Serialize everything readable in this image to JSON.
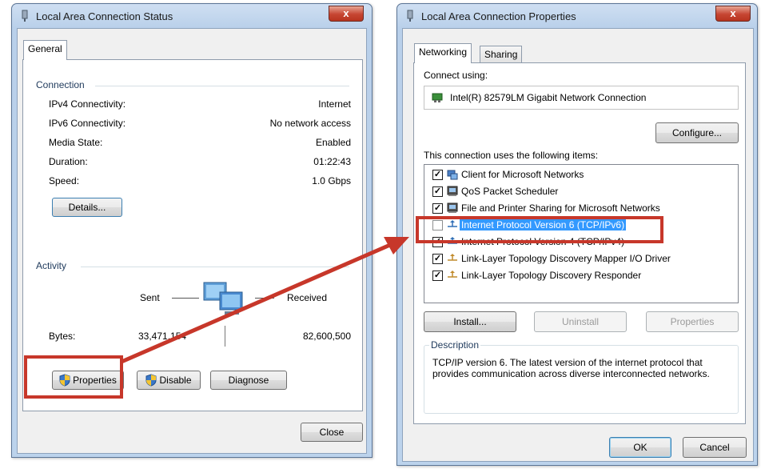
{
  "status_window": {
    "title": "Local Area Connection Status",
    "close_glyph": "x",
    "tabs": [
      {
        "label": "General"
      }
    ],
    "connection": {
      "group_label": "Connection",
      "rows": [
        {
          "label": "IPv4 Connectivity:",
          "value": "Internet"
        },
        {
          "label": "IPv6 Connectivity:",
          "value": "No network access"
        },
        {
          "label": "Media State:",
          "value": "Enabled"
        },
        {
          "label": "Duration:",
          "value": "01:22:43"
        },
        {
          "label": "Speed:",
          "value": "1.0 Gbps"
        }
      ],
      "details_button": "Details..."
    },
    "activity": {
      "group_label": "Activity",
      "sent_label": "Sent",
      "received_label": "Received",
      "bytes_label": "Bytes:",
      "bytes_sent": "33,471,154",
      "bytes_received": "82,600,500"
    },
    "buttons": {
      "properties": "Properties",
      "disable": "Disable",
      "diagnose": "Diagnose",
      "close": "Close"
    }
  },
  "properties_window": {
    "title": "Local Area Connection Properties",
    "close_glyph": "x",
    "tabs": [
      {
        "label": "Networking"
      },
      {
        "label": "Sharing"
      }
    ],
    "connect_using_label": "Connect using:",
    "adapter_name": "Intel(R) 82579LM Gigabit Network Connection",
    "configure_button": "Configure...",
    "items_label": "This connection uses the following items:",
    "items": [
      {
        "label": "Client for Microsoft Networks",
        "checked": true,
        "icon": "network-client-icon"
      },
      {
        "label": "QoS Packet Scheduler",
        "checked": true,
        "icon": "service-icon"
      },
      {
        "label": "File and Printer Sharing for Microsoft Networks",
        "checked": true,
        "icon": "service-icon"
      },
      {
        "label": "Internet Protocol Version 6 (TCP/IPv6)",
        "checked": false,
        "icon": "protocol-icon",
        "selected": true
      },
      {
        "label": "Internet Protocol Version 4 (TCP/IPv4)",
        "checked": true,
        "icon": "protocol-icon"
      },
      {
        "label": "Link-Layer Topology Discovery Mapper I/O Driver",
        "checked": true,
        "icon": "protocol-icon"
      },
      {
        "label": "Link-Layer Topology Discovery Responder",
        "checked": true,
        "icon": "protocol-icon"
      }
    ],
    "buttons": {
      "install": "Install...",
      "uninstall": "Uninstall",
      "properties": "Properties",
      "ok": "OK",
      "cancel": "Cancel"
    },
    "description": {
      "group_label": "Description",
      "text": "TCP/IP version 6. The latest version of the internet protocol that provides communication across diverse interconnected networks."
    }
  },
  "colors": {
    "highlight": "#c7372a",
    "selection": "#3399ff"
  }
}
